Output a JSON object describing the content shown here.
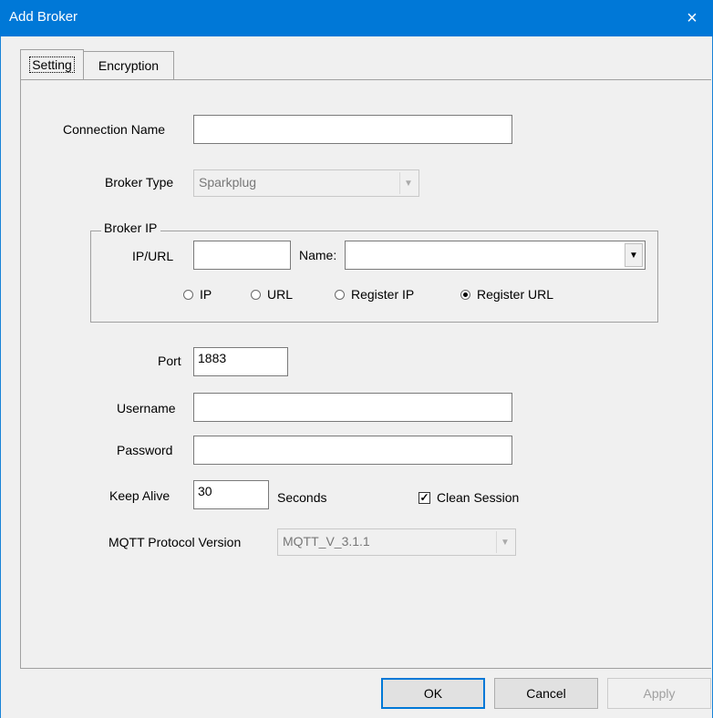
{
  "window": {
    "title": "Add Broker",
    "close_icon": "×"
  },
  "tabs": [
    {
      "label": "Setting"
    },
    {
      "label": "Encryption"
    }
  ],
  "form": {
    "connection_name_label": "Connection Name",
    "connection_name_value": "",
    "broker_type_label": "Broker Type",
    "broker_type_value": "Sparkplug",
    "broker_ip": {
      "group_title": "Broker IP",
      "ip_url_label": "IP/URL",
      "ip_url_value": "",
      "name_label": "Name:",
      "name_value": "",
      "radios": [
        {
          "label": "IP",
          "selected": false
        },
        {
          "label": "URL",
          "selected": false
        },
        {
          "label": "Register IP",
          "selected": false
        },
        {
          "label": "Register URL",
          "selected": true
        }
      ]
    },
    "port_label": "Port",
    "port_value": "1883",
    "username_label": "Username",
    "username_value": "",
    "password_label": "Password",
    "password_value": "",
    "keep_alive_label": "Keep Alive",
    "keep_alive_value": "30",
    "seconds_label": "Seconds",
    "clean_session_label": "Clean Session",
    "clean_session_checked": true,
    "mqtt_version_label": "MQTT Protocol Version",
    "mqtt_version_value": "MQTT_V_3.1.1"
  },
  "buttons": {
    "ok": "OK",
    "cancel": "Cancel",
    "apply": "Apply"
  },
  "colors": {
    "titlebar": "#0078d7",
    "dialog_bg": "#f0f0f0"
  },
  "icons": {
    "dropdown": "chevron-down-icon",
    "checkmark": "checkmark-icon"
  }
}
